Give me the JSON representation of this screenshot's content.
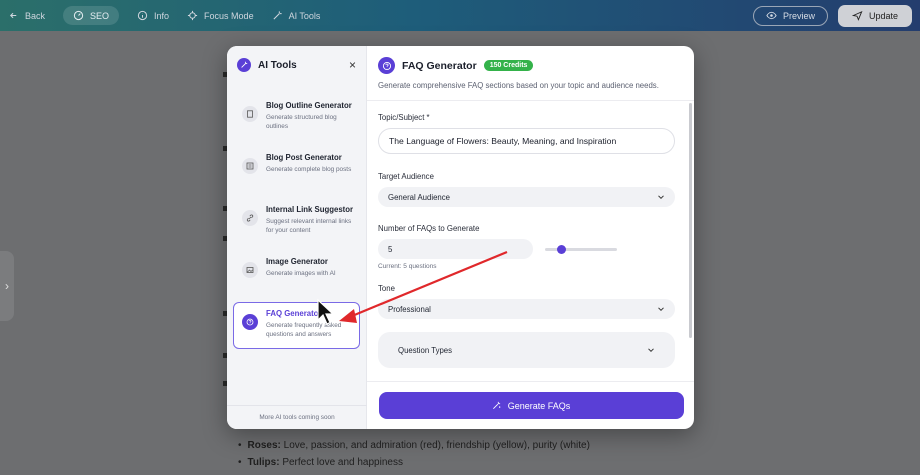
{
  "topbar": {
    "back": "Back",
    "seo": "SEO",
    "info": "Info",
    "focus": "Focus Mode",
    "ai_tools": "AI Tools",
    "preview": "Preview",
    "update": "Update"
  },
  "background": {
    "list": [
      {
        "bold": "Roses:",
        "text": "Love, passion, and admiration (red), friendship (yellow), purity (white)"
      },
      {
        "bold": "Tulips:",
        "text": "Perfect love and happiness"
      }
    ]
  },
  "sidebar": {
    "title": "AI Tools",
    "close": "×",
    "tools": [
      {
        "name": "Blog Outline Generator",
        "desc": "Generate structured blog outlines"
      },
      {
        "name": "Blog Post Generator",
        "desc": "Generate complete blog posts"
      },
      {
        "name": "Internal Link Suggestor",
        "desc": "Suggest relevant internal links for your content"
      },
      {
        "name": "Image Generator",
        "desc": "Generate images with AI"
      },
      {
        "name": "FAQ Generator",
        "desc": "Generate frequently asked questions and answers"
      }
    ],
    "footer": "More AI tools coming soon"
  },
  "panel": {
    "title": "FAQ Generator",
    "credits": "150 Credits",
    "subtitle": "Generate comprehensive FAQ sections based on your topic and audience needs.",
    "topic_label": "Topic/Subject *",
    "topic_value": "The Language of Flowers: Beauty, Meaning, and Inspiration",
    "audience_label": "Target Audience",
    "audience_value": "General Audience",
    "count_label": "Number of FAQs to Generate",
    "count_value": "5",
    "count_hint": "Current: 5 questions",
    "tone_label": "Tone",
    "tone_value": "Professional",
    "qtypes_label": "Question Types",
    "generate_label": "Generate FAQs"
  },
  "colors": {
    "accent": "#5a3fd6",
    "credits_badge": "#34b24a",
    "annotation_arrow": "#e0282b"
  },
  "slider_fraction": 0.2
}
